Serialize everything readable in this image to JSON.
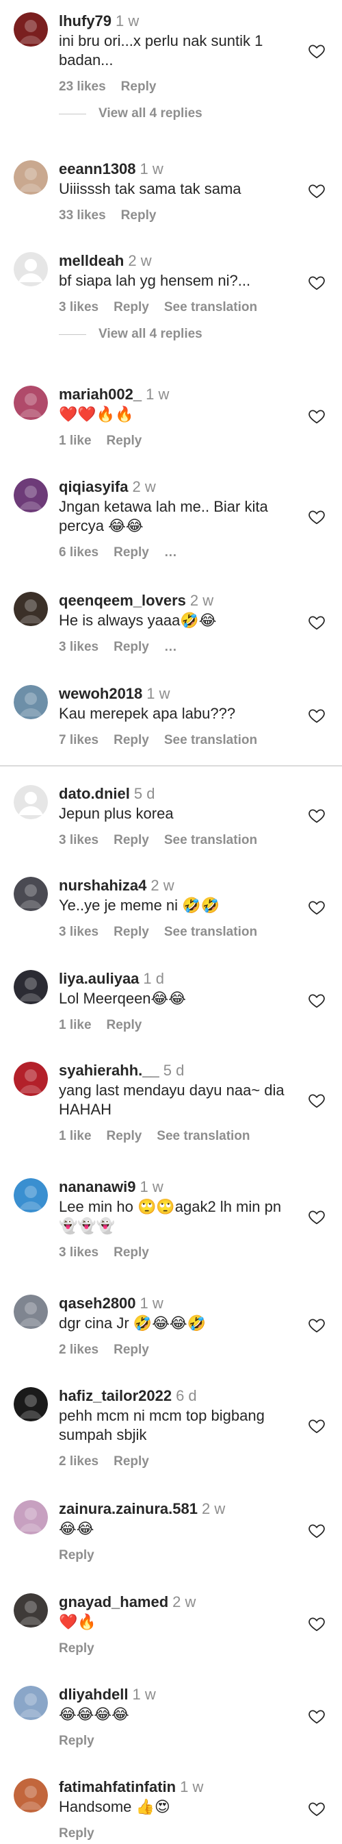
{
  "comments": [
    {
      "username": "lhufy79",
      "time": "1 w",
      "text": "ini bru ori...x perlu nak suntik 1\nbadan...",
      "likes": "23 likes",
      "reply": "Reply",
      "translate": "",
      "replies": "View all 4 replies",
      "avatar": "#7a1f1f",
      "divider": false
    },
    {
      "username": "eeann1308",
      "time": "1 w",
      "text": "Uiiisssh tak sama tak sama",
      "likes": "33 likes",
      "reply": "Reply",
      "translate": "",
      "replies": "",
      "avatar": "#c9a88f",
      "divider": false
    },
    {
      "username": "melldeah",
      "time": "2 w",
      "text": "bf siapa lah yg hensem ni?...",
      "likes": "3 likes",
      "reply": "Reply",
      "translate": "See translation",
      "replies": "View all 4 replies",
      "avatar": "#dbdbdb",
      "divider": false
    },
    {
      "username": "mariah002_",
      "time": "1 w",
      "text": "❤️❤️🔥🔥",
      "likes": "1 like",
      "reply": "Reply",
      "translate": "",
      "replies": "",
      "avatar": "#b04a6a",
      "divider": false
    },
    {
      "username": "qiqiasyifa",
      "time": "2 w",
      "text": "Jngan ketawa lah me.. Biar kita\npercya 😂😂",
      "likes": "6 likes",
      "reply": "Reply",
      "translate": "…",
      "replies": "",
      "avatar": "#6d3b78",
      "divider": false
    },
    {
      "username": "qeenqeem_lovers",
      "time": "2 w",
      "text": "He is always yaaa🤣😂",
      "likes": "3 likes",
      "reply": "Reply",
      "translate": "…",
      "replies": "",
      "avatar": "#3b3028",
      "divider": false
    },
    {
      "username": "wewoh2018",
      "time": "1 w",
      "text": "Kau merepek apa labu???",
      "likes": "7 likes",
      "reply": "Reply",
      "translate": "See translation",
      "replies": "",
      "avatar": "#6d8fa8",
      "divider": true
    },
    {
      "username": "dato.dniel",
      "time": "5 d",
      "text": "Jepun plus korea",
      "likes": "3 likes",
      "reply": "Reply",
      "translate": "See translation",
      "replies": "",
      "avatar": "#dbdbdb",
      "divider": false
    },
    {
      "username": "nurshahiza4",
      "time": "2 w",
      "text": "Ye..ye je meme ni 🤣🤣",
      "likes": "3 likes",
      "reply": "Reply",
      "translate": "See translation",
      "replies": "",
      "avatar": "#4a4a52",
      "divider": false
    },
    {
      "username": "liya.auliyaa",
      "time": "1 d",
      "text": "Lol Meerqeen😂😂",
      "likes": "1 like",
      "reply": "Reply",
      "translate": "",
      "replies": "",
      "avatar": "#2b2b33",
      "divider": false
    },
    {
      "username": "syahierahh.__",
      "time": "5 d",
      "text": "yang last mendayu dayu naa~ dia\nHAHAH",
      "likes": "1 like",
      "reply": "Reply",
      "translate": "See translation",
      "replies": "",
      "avatar": "#b3202a",
      "divider": false
    },
    {
      "username": "nananawi9",
      "time": "1 w",
      "text": "Lee min ho 🙄🙄agak2 lh min pn\n👻👻👻",
      "likes": "3 likes",
      "reply": "Reply",
      "translate": "",
      "replies": "",
      "avatar": "#3a8fd0",
      "divider": false
    },
    {
      "username": "qaseh2800",
      "time": "1 w",
      "text": "dgr cina Jr 🤣😂😂🤣",
      "likes": "2 likes",
      "reply": "Reply",
      "translate": "",
      "replies": "",
      "avatar": "#7f8590",
      "divider": false
    },
    {
      "username": "hafiz_tailor2022",
      "time": "6 d",
      "text": "pehh mcm ni mcm top bigbang\nsumpah sbjik",
      "likes": "2 likes",
      "reply": "Reply",
      "translate": "",
      "replies": "",
      "avatar": "#1a1a1a",
      "divider": false
    },
    {
      "username": "zainura.zainura.581",
      "time": "2 w",
      "text": "😂😂",
      "likes": "",
      "reply": "Reply",
      "translate": "",
      "replies": "",
      "avatar": "#c7a0c0",
      "divider": false
    },
    {
      "username": "gnayad_hamed",
      "time": "2 w",
      "text": "❤️🔥",
      "likes": "",
      "reply": "Reply",
      "translate": "",
      "replies": "",
      "avatar": "#3e3a38",
      "divider": false
    },
    {
      "username": "dliyahdell",
      "time": "1 w",
      "text": "😂😂😂😂",
      "likes": "",
      "reply": "Reply",
      "translate": "",
      "replies": "",
      "avatar": "#8aa6c8",
      "divider": false
    },
    {
      "username": "fatimahfatinfatin",
      "time": "1 w",
      "text": "Handsome 👍😍",
      "likes": "",
      "reply": "Reply",
      "translate": "",
      "replies": "",
      "avatar": "#c2663c",
      "divider": false
    }
  ],
  "icons": {
    "heart": "heart-icon",
    "more": "more-icon"
  }
}
